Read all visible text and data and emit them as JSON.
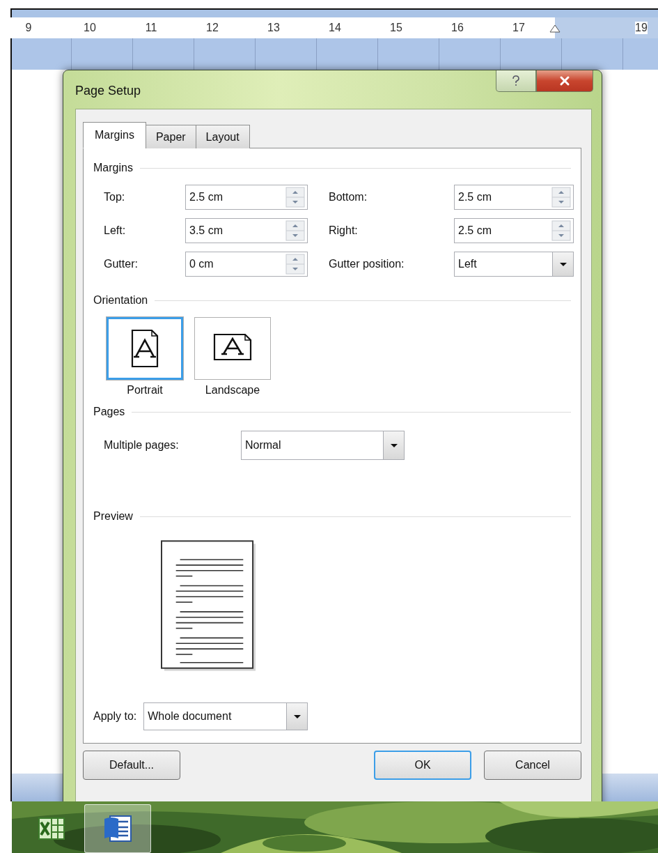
{
  "ruler": {
    "marks": [
      {
        "kind": "number",
        "label": "9"
      },
      {
        "kind": "number",
        "label": "10"
      },
      {
        "kind": "number",
        "label": "11"
      },
      {
        "kind": "number",
        "label": "12"
      },
      {
        "kind": "number",
        "label": "13"
      },
      {
        "kind": "number",
        "label": "14"
      },
      {
        "kind": "number",
        "label": "15"
      },
      {
        "kind": "number",
        "label": "16"
      },
      {
        "kind": "number",
        "label": "17"
      },
      {
        "kind": "marker"
      },
      {
        "kind": "number",
        "label": "19"
      }
    ]
  },
  "dialog": {
    "title": "Page Setup",
    "tabs": [
      {
        "label": "Margins",
        "selected": true
      },
      {
        "label": "Paper",
        "selected": false
      },
      {
        "label": "Layout",
        "selected": false
      }
    ],
    "margins": {
      "heading": "Margins",
      "fields": [
        {
          "label": "Top:",
          "value": "2.5 cm",
          "kind": "spin"
        },
        {
          "label": "Bottom:",
          "value": "2.5 cm",
          "kind": "spin"
        },
        {
          "label": "Left:",
          "value": "3.5 cm",
          "kind": "spin"
        },
        {
          "label": "Right:",
          "value": "2.5 cm",
          "kind": "spin"
        },
        {
          "label": "Gutter:",
          "value": "0 cm",
          "kind": "spin"
        },
        {
          "label": "Gutter position:",
          "value": "Left",
          "kind": "dropdown"
        }
      ]
    },
    "orientation": {
      "heading": "Orientation",
      "options": [
        {
          "label": "Portrait",
          "kind": "portrait",
          "selected": true
        },
        {
          "label": "Landscape",
          "kind": "landscape",
          "selected": false
        }
      ]
    },
    "pages": {
      "heading": "Pages",
      "label": "Multiple pages:",
      "value": "Normal"
    },
    "preview": {
      "heading": "Preview"
    },
    "apply_to": {
      "label": "Apply to:",
      "value": "Whole document"
    },
    "buttons": [
      {
        "label": "Default...",
        "focused": false
      },
      {
        "label": "OK",
        "focused": true
      },
      {
        "label": "Cancel",
        "focused": false
      }
    ]
  },
  "taskbar": {
    "items": [
      {
        "kind": "spreadsheet",
        "selected": false
      },
      {
        "kind": "document",
        "selected": true
      }
    ]
  }
}
